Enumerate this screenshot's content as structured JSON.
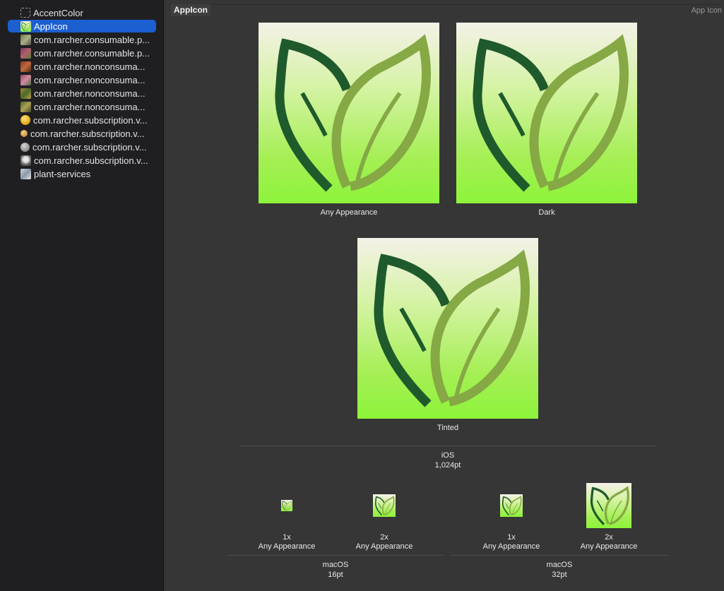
{
  "sidebar": {
    "items": [
      {
        "label": "AccentColor",
        "thumb": "dashed-color-swatch-icon"
      },
      {
        "label": "AppIcon",
        "thumb": "leaf-app-icon",
        "selected": true
      },
      {
        "label": "com.rarcher.consumable.p...",
        "thumb": "plant-photo-thumbnail"
      },
      {
        "label": "com.rarcher.consumable.p...",
        "thumb": "plant-photo-thumbnail"
      },
      {
        "label": "com.rarcher.nonconsuma...",
        "thumb": "plant-photo-thumbnail"
      },
      {
        "label": "com.rarcher.nonconsuma...",
        "thumb": "plant-photo-thumbnail"
      },
      {
        "label": "com.rarcher.nonconsuma...",
        "thumb": "plant-photo-thumbnail"
      },
      {
        "label": "com.rarcher.nonconsuma...",
        "thumb": "plant-photo-thumbnail"
      },
      {
        "label": "com.rarcher.subscription.v...",
        "thumb": "gold-coin-icon"
      },
      {
        "label": "com.rarcher.subscription.v...",
        "thumb": "bronze-coin-icon"
      },
      {
        "label": "com.rarcher.subscription.v...",
        "thumb": "silver-coin-icon"
      },
      {
        "label": "com.rarcher.subscription.v...",
        "thumb": "platinum-badge-icon"
      },
      {
        "label": "plant-services",
        "thumb": "services-photo-thumbnail"
      }
    ]
  },
  "main": {
    "set_title": "AppIcon",
    "set_type": "App Icon",
    "large_icons": [
      {
        "caption": "Any Appearance"
      },
      {
        "caption": "Dark"
      },
      {
        "caption": "Tinted"
      }
    ],
    "ios_group": {
      "platform": "iOS",
      "size": "1,024pt"
    },
    "mac_16": {
      "platform": "macOS",
      "size": "16pt",
      "slots": [
        {
          "scale": "1x",
          "appearance": "Any Appearance"
        },
        {
          "scale": "2x",
          "appearance": "Any Appearance"
        }
      ]
    },
    "mac_32": {
      "platform": "macOS",
      "size": "32pt",
      "slots": [
        {
          "scale": "1x",
          "appearance": "Any Appearance"
        },
        {
          "scale": "2x",
          "appearance": "Any Appearance"
        }
      ]
    }
  },
  "colors": {
    "selection": "#1b5fd1",
    "leaf_dark": "#1f5a2c",
    "leaf_light": "#86a845",
    "icon_bg_top": "#f4f1e8",
    "icon_bg_bottom": "#8df43a"
  }
}
